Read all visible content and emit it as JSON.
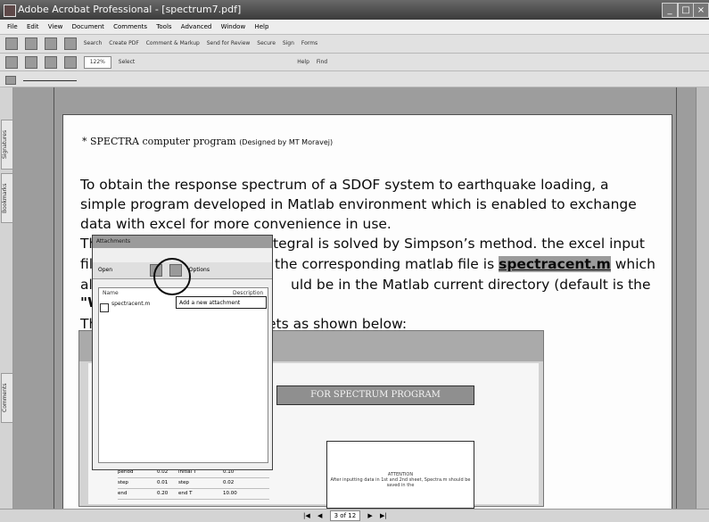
{
  "window": {
    "title": "Adobe Acrobat Professional - [spectrum7.pdf]"
  },
  "menu": [
    "File",
    "Edit",
    "View",
    "Document",
    "Comments",
    "Tools",
    "Advanced",
    "Window",
    "Help"
  ],
  "toolbar1": {
    "search": "Search",
    "create_pdf": "Create PDF",
    "comment": "Comment & Markup",
    "send_review": "Send for Review",
    "secure": "Secure",
    "sign": "Sign",
    "forms": "Forms"
  },
  "toolbar2": {
    "zoom": "122%",
    "select": "Select",
    "help": "Help",
    "find": "Find"
  },
  "left_tabs": {
    "signatures": "Signatures",
    "bookmarks": "Bookmarks",
    "comments": "Comments"
  },
  "document": {
    "line1_main": "* SPECTRA computer program",
    "line1_note": "(Designed by MT Moravej)",
    "p1": [
      "To obtain the response spectrum of a SDOF system to earthquake loading, a",
      "simple program developed in Matlab environment which is enabled to exchange",
      "data with excel for more convenience in use."
    ],
    "p2a": "tegral is solved by Simpson’s method. the excel input",
    "p2b_pre": "the corresponding matlab file is ",
    "p2b_hl": "spectracent.m",
    "p2b_post": " which",
    "p2c": "uld be in the Matlab current directory (default is the",
    "p3": "ets as shown below:",
    "p2_start": "Th",
    "p3_start": "Th",
    "fil": "fil",
    "al": "al",
    "w": "\"W"
  },
  "attachments_panel": {
    "title": "Attachments",
    "open": "Open",
    "options": "Options",
    "name_col": "Name",
    "desc_col": "Description",
    "file": "spectracent.m"
  },
  "tooltip": "Add a new attachment",
  "excel": {
    "banner": "FOR SPECTRUM PROGRAM",
    "note_title": "ATTENTION",
    "note_body": "After inputting data in 1st and 2nd sheet, Spectra.m should be saved in the",
    "rows": [
      [
        "period",
        "0.02",
        "initial T",
        "0.10"
      ],
      [
        "step",
        "0.01",
        "step",
        "0.02"
      ],
      [
        "end",
        "0.20",
        "end T",
        "10.00"
      ]
    ]
  },
  "status": {
    "page": "3 of 12"
  }
}
